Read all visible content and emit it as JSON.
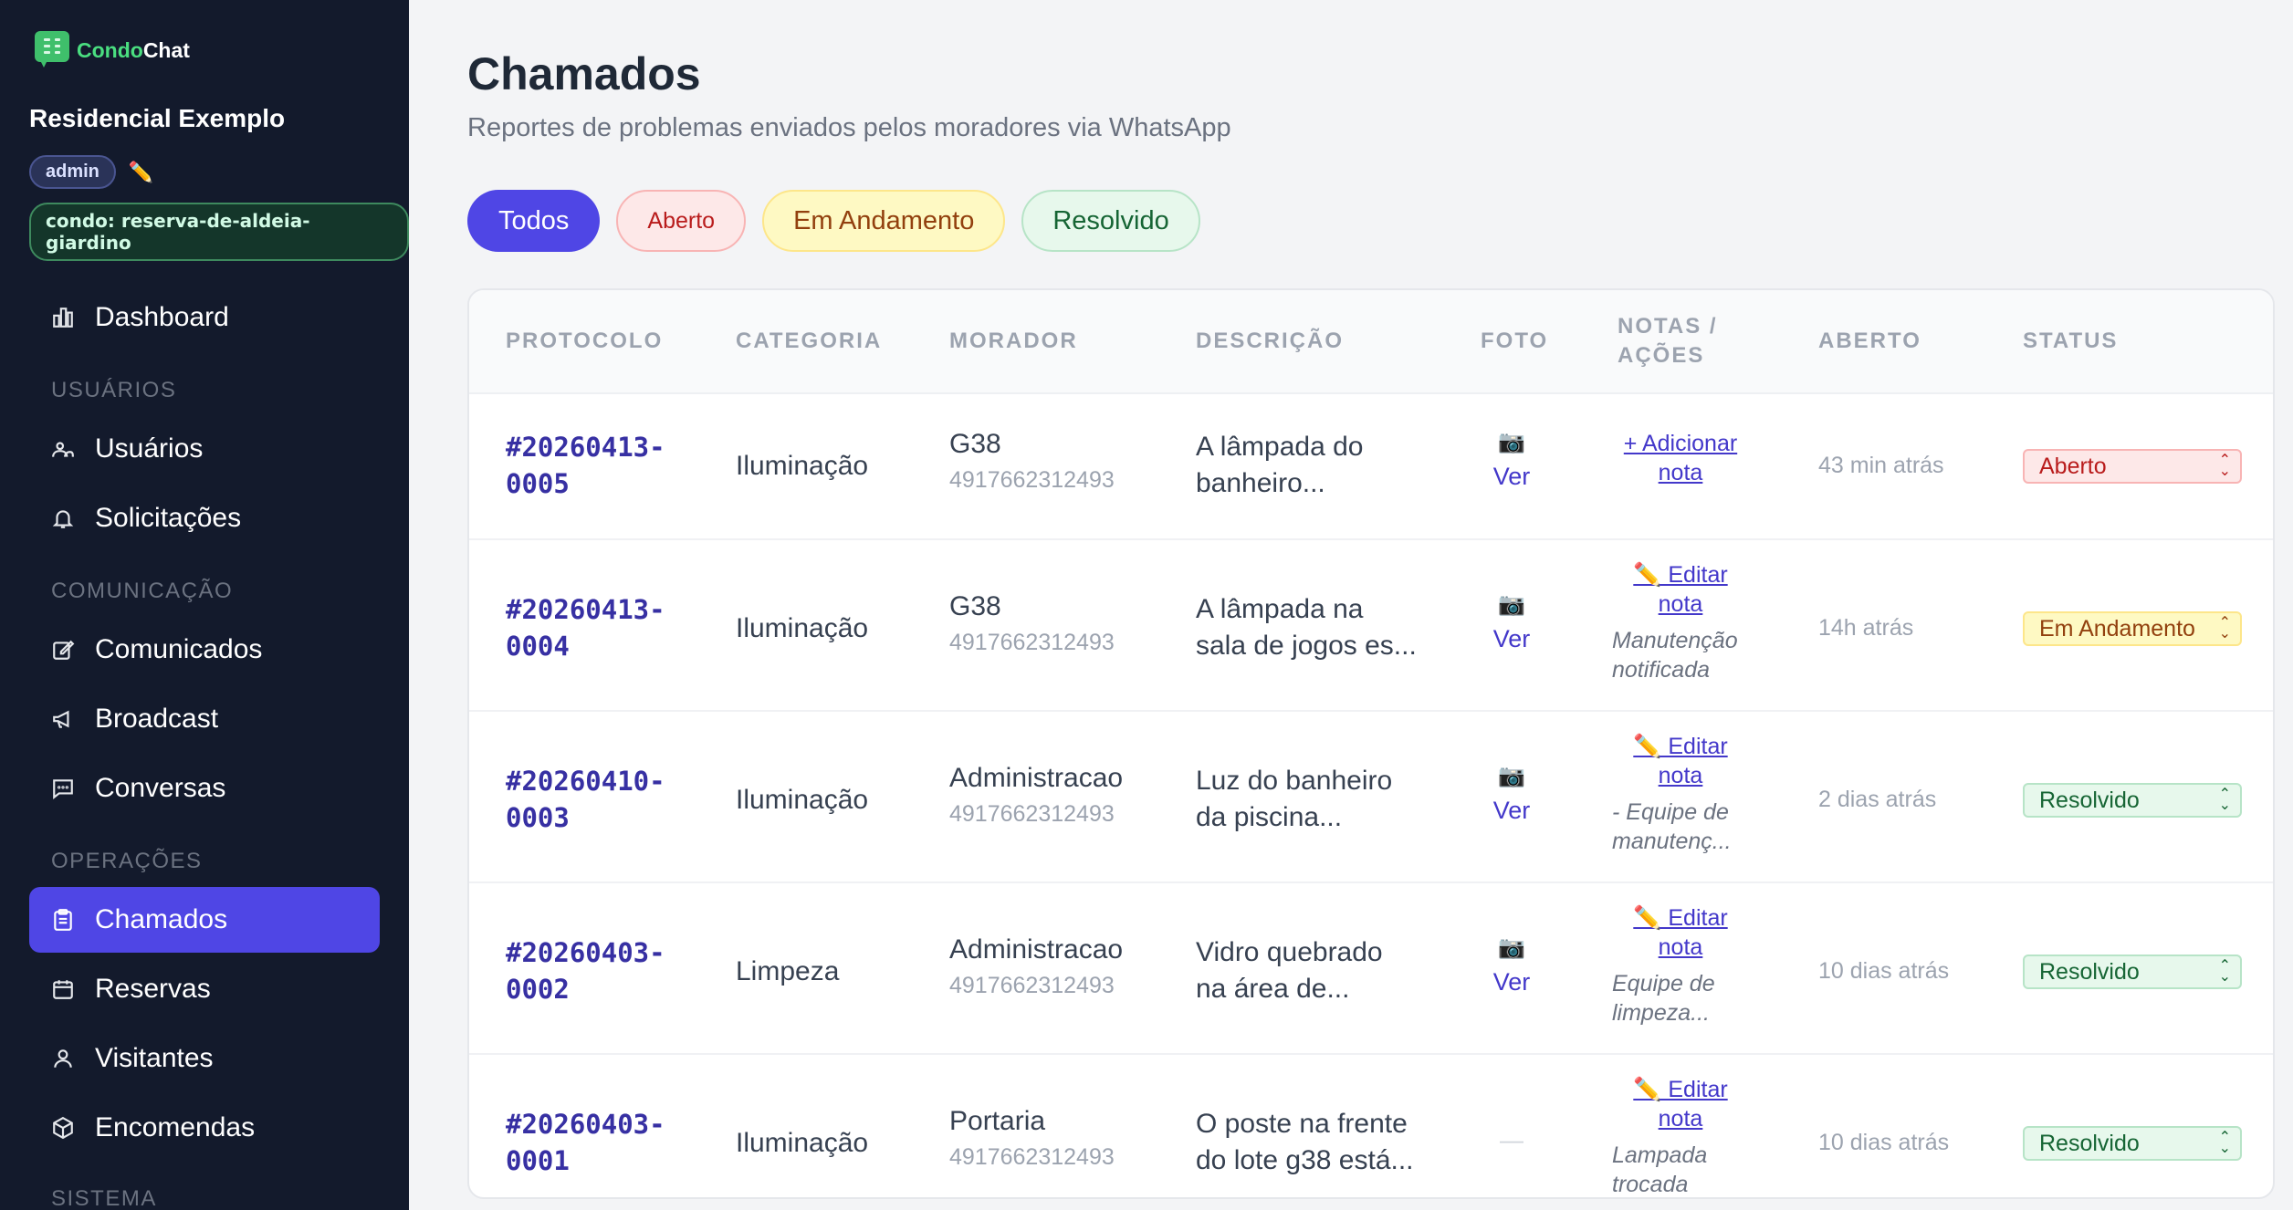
{
  "brand": {
    "part1": "Condo",
    "part2": "Chat"
  },
  "sidebar": {
    "condo_title": "Residencial Exemplo",
    "role": "admin",
    "condo_badge": "condo: reserva-de-aldeia-giardino",
    "sections": {
      "usuarios": "USUÁRIOS",
      "comunicacao": "COMUNICAÇÃO",
      "operacoes": "OPERAÇÕES",
      "sistema": "SISTEMA"
    },
    "items": [
      {
        "label": "Dashboard",
        "icon": "chart-bar-icon"
      },
      {
        "label": "Usuários",
        "icon": "users-icon"
      },
      {
        "label": "Solicitações",
        "icon": "bell-icon"
      },
      {
        "label": "Comunicados",
        "icon": "edit-square-icon"
      },
      {
        "label": "Broadcast",
        "icon": "megaphone-icon"
      },
      {
        "label": "Conversas",
        "icon": "chat-icon"
      },
      {
        "label": "Chamados",
        "icon": "clipboard-icon",
        "active": true
      },
      {
        "label": "Reservas",
        "icon": "calendar-icon"
      },
      {
        "label": "Visitantes",
        "icon": "user-icon"
      },
      {
        "label": "Encomendas",
        "icon": "package-icon"
      }
    ]
  },
  "main": {
    "title": "Chamados",
    "subtitle": "Reportes de problemas enviados pelos moradores via WhatsApp",
    "filters": [
      "Todos",
      "Aberto",
      "Em Andamento",
      "Resolvido"
    ]
  },
  "table": {
    "headers": {
      "protocolo": "PROTOCOLO",
      "categoria": "CATEGORIA",
      "morador": "MORADOR",
      "descricao": "DESCRIÇÃO",
      "foto": "FOTO",
      "notas_1": "NOTAS /",
      "notas_2": "AÇÕES",
      "aberto": "ABERTO",
      "status": "STATUS"
    },
    "rows": [
      {
        "protocol_1": "#20260413-",
        "protocol_2": "0005",
        "categoria": "Iluminação",
        "morador": "G38",
        "phone": "4917662312493",
        "desc_1": "A lâmpada do",
        "desc_2": "banheiro...",
        "foto_icon": "📷",
        "foto_link": "Ver",
        "nota_link_1": "+ Adicionar",
        "nota_link_2": "nota",
        "nota_1": "",
        "nota_2": "",
        "aberto": "43 min atrás",
        "status": "Aberto",
        "status_color": "#b91c1c"
      },
      {
        "protocol_1": "#20260413-",
        "protocol_2": "0004",
        "categoria": "Iluminação",
        "morador": "G38",
        "phone": "4917662312493",
        "desc_1": "A lâmpada na",
        "desc_2": "sala de jogos es...",
        "foto_icon": "📷",
        "foto_link": "Ver",
        "nota_link_1": "✏️ Editar",
        "nota_link_2": "nota",
        "nota_1": "Manutenção",
        "nota_2": "notificada",
        "aberto": "14h atrás",
        "status": "Em Andamento",
        "status_color": "#92400e"
      },
      {
        "protocol_1": "#20260410-",
        "protocol_2": "0003",
        "categoria": "Iluminação",
        "morador": "Administracao",
        "phone": "4917662312493",
        "desc_1": "Luz do banheiro",
        "desc_2": "da piscina...",
        "foto_icon": "📷",
        "foto_link": "Ver",
        "nota_link_1": "✏️ Editar",
        "nota_link_2": "nota",
        "nota_1": "- Equipe de",
        "nota_2": "manutenç...",
        "aberto": "2 dias atrás",
        "status": "Resolvido",
        "status_color": "#166534"
      },
      {
        "protocol_1": "#20260403-",
        "protocol_2": "0002",
        "categoria": "Limpeza",
        "morador": "Administracao",
        "phone": "4917662312493",
        "desc_1": "Vidro quebrado",
        "desc_2": "na área de...",
        "foto_icon": "📷",
        "foto_link": "Ver",
        "nota_link_1": "✏️ Editar",
        "nota_link_2": "nota",
        "nota_1": "Equipe de",
        "nota_2": "limpeza...",
        "aberto": "10 dias atrás",
        "status": "Resolvido",
        "status_color": "#166534"
      },
      {
        "protocol_1": "#20260403-",
        "protocol_2": "0001",
        "categoria": "Iluminação",
        "morador": "Portaria",
        "phone": "4917662312493",
        "desc_1": "O poste na frente",
        "desc_2": "do lote g38 está...",
        "foto_icon": "",
        "foto_link": "—",
        "nota_link_1": "✏️ Editar",
        "nota_link_2": "nota",
        "nota_1": "Lampada",
        "nota_2": "trocada",
        "aberto": "10 dias atrás",
        "status": "Resolvido",
        "status_color": "#166534"
      }
    ]
  }
}
